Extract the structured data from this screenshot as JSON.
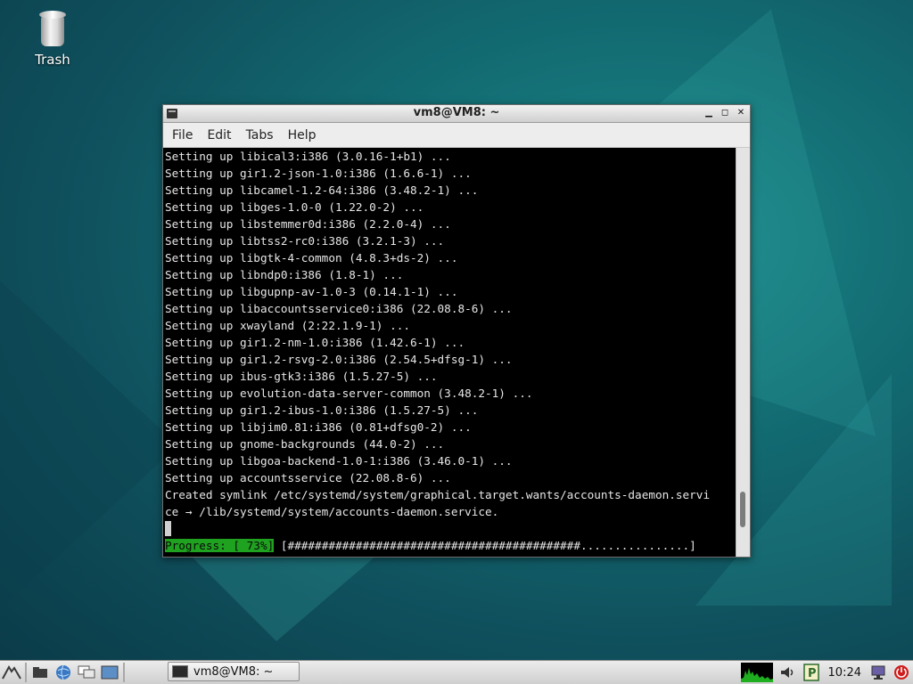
{
  "desktop": {
    "icons": [
      {
        "label": "Trash",
        "icon": "trash-icon"
      }
    ]
  },
  "terminal": {
    "title": "vm8@VM8: ~",
    "menu": [
      "File",
      "Edit",
      "Tabs",
      "Help"
    ],
    "lines": [
      "Setting up libical3:i386 (3.0.16-1+b1) ...",
      "Setting up gir1.2-json-1.0:i386 (1.6.6-1) ...",
      "Setting up libcamel-1.2-64:i386 (3.48.2-1) ...",
      "Setting up libges-1.0-0 (1.22.0-2) ...",
      "Setting up libstemmer0d:i386 (2.2.0-4) ...",
      "Setting up libtss2-rc0:i386 (3.2.1-3) ...",
      "Setting up libgtk-4-common (4.8.3+ds-2) ...",
      "Setting up libndp0:i386 (1.8-1) ...",
      "Setting up libgupnp-av-1.0-3 (0.14.1-1) ...",
      "Setting up libaccountsservice0:i386 (22.08.8-6) ...",
      "Setting up xwayland (2:22.1.9-1) ...",
      "Setting up gir1.2-nm-1.0:i386 (1.42.6-1) ...",
      "Setting up gir1.2-rsvg-2.0:i386 (2.54.5+dfsg-1) ...",
      "Setting up ibus-gtk3:i386 (1.5.27-5) ...",
      "Setting up evolution-data-server-common (3.48.2-1) ...",
      "Setting up gir1.2-ibus-1.0:i386 (1.5.27-5) ...",
      "Setting up libjim0.81:i386 (0.81+dfsg0-2) ...",
      "Setting up gnome-backgrounds (44.0-2) ...",
      "Setting up libgoa-backend-1.0-1:i386 (3.46.0-1) ...",
      "Setting up accountsservice (22.08.8-6) ...",
      "Created symlink /etc/systemd/system/graphical.target.wants/accounts-daemon.servi",
      "ce → /lib/systemd/system/accounts-daemon.service."
    ],
    "progress_label": "Progress: [ 73%]",
    "progress_bar": "[###########################################................]",
    "progress_fraction": 0.73,
    "scrollbar_position": 0.93
  },
  "taskbar": {
    "launchers": [
      "menu-icon",
      "folder-icon",
      "web-browser-icon",
      "window-switch-icon",
      "desktop-icon"
    ],
    "tasks": [
      {
        "label": "vm8@VM8: ~"
      }
    ],
    "clock": "10:24",
    "tray": [
      "cpu-monitor-icon",
      "volume-icon",
      "parcellite-icon",
      "network-icon",
      "power-icon"
    ],
    "colors": {
      "progress": "#1fa21f",
      "power": "#d01c1c"
    }
  }
}
